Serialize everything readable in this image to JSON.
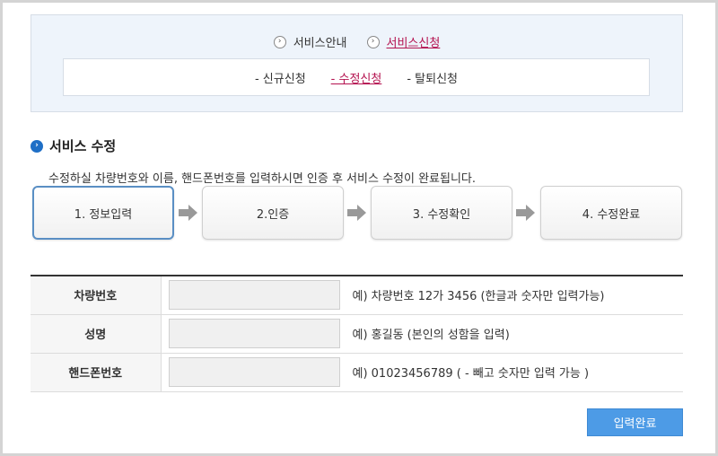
{
  "nav": {
    "top_links": [
      {
        "label": "서비스안내",
        "active": false
      },
      {
        "label": "서비스신청",
        "active": true
      }
    ],
    "sub_links": [
      {
        "label": "- 신규신청",
        "active": false
      },
      {
        "label": "- 수정신청",
        "active": true
      },
      {
        "label": "- 탈퇴신청",
        "active": false
      }
    ]
  },
  "section": {
    "title": "서비스 수정",
    "description": "수정하실 차량번호와 이름, 핸드폰번호를 입력하시면 인증 후 서비스 수정이 완료됩니다."
  },
  "steps": [
    {
      "label": "1. 정보입력",
      "active": true
    },
    {
      "label": "2.인증",
      "active": false
    },
    {
      "label": "3. 수정확인",
      "active": false
    },
    {
      "label": "4. 수정완료",
      "active": false
    }
  ],
  "form": {
    "rows": [
      {
        "label": "차량번호",
        "value": "",
        "hint": "예) 차량번호 12가 3456 (한글과 숫자만 입력가능)"
      },
      {
        "label": "성명",
        "value": "",
        "hint": "예) 홍길동 (본인의 성함을 입력)"
      },
      {
        "label": "핸드폰번호",
        "value": "",
        "hint": "예) 01023456789 ( - 빼고 숫자만 입력 가능 )"
      }
    ]
  },
  "submit_label": "입력완료",
  "icons": {
    "nav_arrow": "circle-chevron-right-icon",
    "section_bullet": "blue-circle-chevron-icon",
    "step_arrow": "gray-arrow-right-icon"
  },
  "colors": {
    "active_link": "#b4124f",
    "accent_blue": "#1f6fc6",
    "submit_bg": "#4d9be6",
    "nav_bg": "#eef4fb"
  }
}
